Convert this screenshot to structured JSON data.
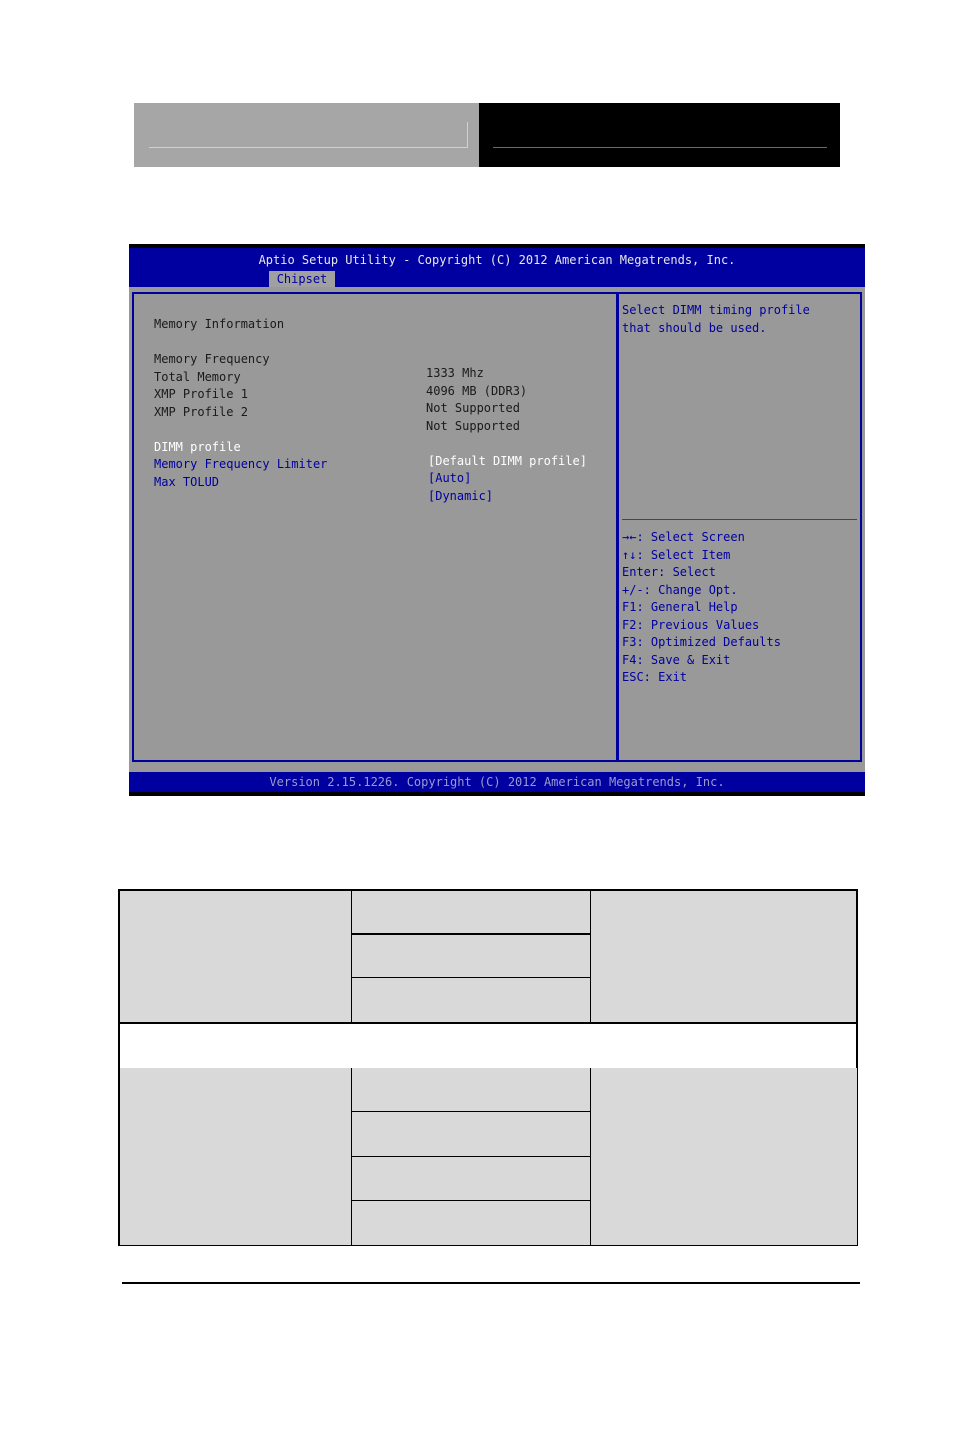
{
  "page_header": {
    "left_text": "",
    "right_text": ""
  },
  "bios": {
    "title": "Aptio Setup Utility - Copyright (C) 2012 American Megatrends, Inc.",
    "active_tab": "Chipset",
    "section_heading": "Memory Information",
    "info_rows": [
      {
        "label": "Memory Frequency",
        "value": "1333 Mhz"
      },
      {
        "label": "Total Memory",
        "value": "4096 MB (DDR3)"
      },
      {
        "label": "XMP Profile 1",
        "value": "Not Supported"
      },
      {
        "label": "XMP Profile 2",
        "value": "Not Supported"
      }
    ],
    "option_rows": [
      {
        "label": "DIMM profile",
        "value": "[Default DIMM profile]",
        "selected": true
      },
      {
        "label": "Memory Frequency Limiter",
        "value": "[Auto]",
        "selected": false
      },
      {
        "label": "Max TOLUD",
        "value": "[Dynamic]",
        "selected": false
      }
    ],
    "help": {
      "description_lines": [
        "Select DIMM timing profile",
        "that should be used."
      ],
      "keys": [
        "→←: Select Screen",
        "↑↓: Select Item",
        "Enter: Select",
        "+/-: Change Opt.",
        "F1: General Help",
        "F2: Previous Values",
        "F3: Optimized Defaults",
        "F4: Save & Exit",
        "ESC: Exit"
      ]
    },
    "footer": "Version 2.15.1226. Copyright (C) 2012 American Megatrends, Inc.",
    "colors": {
      "frame_blue": "#0000a0",
      "panel_gray": "#999999",
      "selected_text": "#ffffff"
    }
  },
  "table": {
    "rows": []
  }
}
